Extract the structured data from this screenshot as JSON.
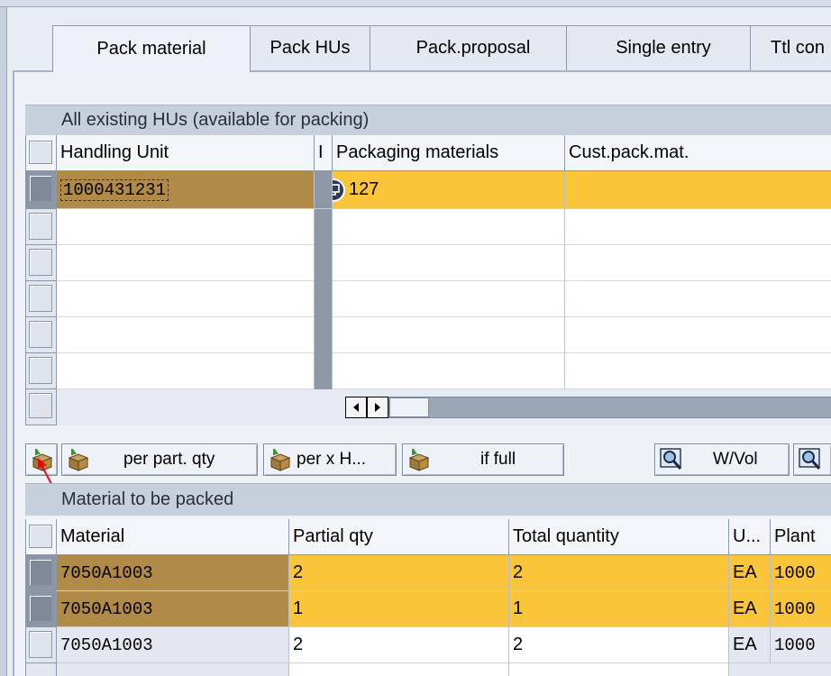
{
  "tabs": [
    {
      "label": "Pack material",
      "active": true
    },
    {
      "label": "Pack HUs",
      "active": false
    },
    {
      "label": "Pack.proposal",
      "active": false
    },
    {
      "label": "Single entry",
      "active": false
    },
    {
      "label": "Ttl con",
      "active": false
    }
  ],
  "hu_section": {
    "title": "All existing HUs (available for packing)",
    "columns": [
      "Handling Unit",
      "I",
      "Packaging materials",
      "Cust.pack.mat."
    ],
    "rows": [
      {
        "handling_unit": "1000431231",
        "packaging_materials": "127",
        "cust_pack_mat": ""
      }
    ]
  },
  "toolbar": {
    "per_part_qty": "per part. qty",
    "per_x_hu": "per x H...",
    "if_full": "if full",
    "w_vol": "W/Vol"
  },
  "material_section": {
    "title": "Material to be packed",
    "columns": [
      "Material",
      "Partial qty",
      "Total quantity",
      "U...",
      "Plant"
    ],
    "rows": [
      {
        "material": "7050A1003",
        "partial_qty": "2",
        "total_quantity": "2",
        "unit": "EA",
        "plant": "1000"
      },
      {
        "material": "7050A1003",
        "partial_qty": "1",
        "total_quantity": "1",
        "unit": "EA",
        "plant": "1000"
      },
      {
        "material": "7050A1003",
        "partial_qty": "2",
        "total_quantity": "2",
        "unit": "EA",
        "plant": "1000"
      }
    ]
  },
  "colors": {
    "selected_key": "#b08a46",
    "selected_row": "#fbc53a",
    "header_group": "#c6cfdc"
  }
}
